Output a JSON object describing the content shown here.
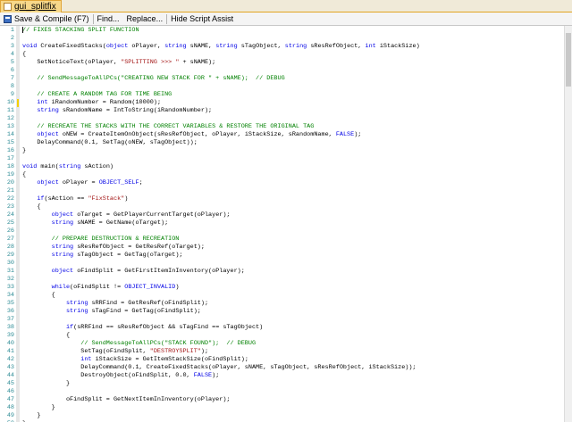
{
  "tab": {
    "label": "gui_splitfix"
  },
  "toolbar": {
    "save_label": "Save & Compile (F7)",
    "find_label": "Find...",
    "replace_label": "Replace...",
    "hide_assist_label": "Hide Script Assist"
  },
  "colors": {
    "keyword": "#0000e6",
    "comment": "#008000",
    "string": "#a31515",
    "line_number": "#2b8a94",
    "change_marker": "#f4d000"
  },
  "lines": [
    {
      "n": "1",
      "tokens": [
        {
          "t": "cmt",
          "v": "// FIXES STACKING SPLIT FUNCTION"
        }
      ]
    },
    {
      "n": "2",
      "tokens": []
    },
    {
      "n": "3",
      "tokens": [
        {
          "t": "kw",
          "v": "void"
        },
        {
          "t": "n",
          "v": " CreateFixedStacks("
        },
        {
          "t": "kw",
          "v": "object"
        },
        {
          "t": "n",
          "v": " oPlayer, "
        },
        {
          "t": "kw",
          "v": "string"
        },
        {
          "t": "n",
          "v": " sNAME, "
        },
        {
          "t": "kw",
          "v": "string"
        },
        {
          "t": "n",
          "v": " sTagObject, "
        },
        {
          "t": "kw",
          "v": "string"
        },
        {
          "t": "n",
          "v": " sResRefObject, "
        },
        {
          "t": "kw",
          "v": "int"
        },
        {
          "t": "n",
          "v": " iStackSize)"
        }
      ]
    },
    {
      "n": "4",
      "tokens": [
        {
          "t": "n",
          "v": "{"
        }
      ]
    },
    {
      "n": "5",
      "tokens": [
        {
          "t": "n",
          "v": "    SetNoticeText(oPlayer, "
        },
        {
          "t": "str",
          "v": "\"SPLITTING >>> \""
        },
        {
          "t": "n",
          "v": " + sNAME);"
        }
      ]
    },
    {
      "n": "6",
      "tokens": []
    },
    {
      "n": "7",
      "tokens": [
        {
          "t": "cmt",
          "v": "    // SendMessageToAllPCs(\"CREATING NEW STACK FOR \" + sNAME);  // DEBUG"
        }
      ]
    },
    {
      "n": "8",
      "tokens": []
    },
    {
      "n": "9",
      "tokens": [
        {
          "t": "cmt",
          "v": "    // CREATE A RANDOM TAG FOR TIME BEING"
        }
      ]
    },
    {
      "n": "10",
      "tokens": [
        {
          "t": "n",
          "v": "    "
        },
        {
          "t": "kw",
          "v": "int"
        },
        {
          "t": "n",
          "v": " iRandomNumber = Random(10000);"
        }
      ],
      "changed": true
    },
    {
      "n": "11",
      "tokens": [
        {
          "t": "n",
          "v": "    "
        },
        {
          "t": "kw",
          "v": "string"
        },
        {
          "t": "n",
          "v": " sRandomName = IntToString(iRandomNumber);"
        }
      ]
    },
    {
      "n": "12",
      "tokens": []
    },
    {
      "n": "13",
      "tokens": [
        {
          "t": "cmt",
          "v": "    // RECREATE THE STACKS WITH THE CORRECT VARIABLES & RESTORE THE ORIGINAL TAG"
        }
      ]
    },
    {
      "n": "14",
      "tokens": [
        {
          "t": "n",
          "v": "    "
        },
        {
          "t": "kw",
          "v": "object"
        },
        {
          "t": "n",
          "v": " oNEW = CreateItemOnObject(sResRefObject, oPlayer, iStackSize, sRandomName, "
        },
        {
          "t": "const",
          "v": "FALSE"
        },
        {
          "t": "n",
          "v": ");"
        }
      ]
    },
    {
      "n": "15",
      "tokens": [
        {
          "t": "n",
          "v": "    DelayCommand(0.1, SetTag(oNEW, sTagObject));"
        }
      ]
    },
    {
      "n": "16",
      "tokens": [
        {
          "t": "n",
          "v": "}"
        }
      ]
    },
    {
      "n": "17",
      "tokens": []
    },
    {
      "n": "18",
      "tokens": [
        {
          "t": "kw",
          "v": "void"
        },
        {
          "t": "n",
          "v": " main("
        },
        {
          "t": "kw",
          "v": "string"
        },
        {
          "t": "n",
          "v": " sAction)"
        }
      ]
    },
    {
      "n": "19",
      "tokens": [
        {
          "t": "n",
          "v": "{"
        }
      ]
    },
    {
      "n": "20",
      "tokens": [
        {
          "t": "n",
          "v": "    "
        },
        {
          "t": "kw",
          "v": "object"
        },
        {
          "t": "n",
          "v": " oPlayer = "
        },
        {
          "t": "const",
          "v": "OBJECT_SELF"
        },
        {
          "t": "n",
          "v": ";"
        }
      ]
    },
    {
      "n": "21",
      "tokens": []
    },
    {
      "n": "22",
      "tokens": [
        {
          "t": "n",
          "v": "    "
        },
        {
          "t": "kw",
          "v": "if"
        },
        {
          "t": "n",
          "v": "(sAction == "
        },
        {
          "t": "str",
          "v": "\"FixStack\""
        },
        {
          "t": "n",
          "v": ")"
        }
      ]
    },
    {
      "n": "23",
      "tokens": [
        {
          "t": "n",
          "v": "    {"
        }
      ]
    },
    {
      "n": "24",
      "tokens": [
        {
          "t": "n",
          "v": "        "
        },
        {
          "t": "kw",
          "v": "object"
        },
        {
          "t": "n",
          "v": " oTarget = GetPlayerCurrentTarget(oPlayer);"
        }
      ]
    },
    {
      "n": "25",
      "tokens": [
        {
          "t": "n",
          "v": "        "
        },
        {
          "t": "kw",
          "v": "string"
        },
        {
          "t": "n",
          "v": " sNAME = GetName(oTarget);"
        }
      ]
    },
    {
      "n": "26",
      "tokens": []
    },
    {
      "n": "27",
      "tokens": [
        {
          "t": "cmt",
          "v": "        // PREPARE DESTRUCTION & RECREATION"
        }
      ]
    },
    {
      "n": "28",
      "tokens": [
        {
          "t": "n",
          "v": "        "
        },
        {
          "t": "kw",
          "v": "string"
        },
        {
          "t": "n",
          "v": " sResRefObject = GetResRef(oTarget);"
        }
      ]
    },
    {
      "n": "29",
      "tokens": [
        {
          "t": "n",
          "v": "        "
        },
        {
          "t": "kw",
          "v": "string"
        },
        {
          "t": "n",
          "v": " sTagObject = GetTag(oTarget);"
        }
      ]
    },
    {
      "n": "30",
      "tokens": []
    },
    {
      "n": "31",
      "tokens": [
        {
          "t": "n",
          "v": "        "
        },
        {
          "t": "kw",
          "v": "object"
        },
        {
          "t": "n",
          "v": " oFindSplit = GetFirstItemInInventory(oPlayer);"
        }
      ]
    },
    {
      "n": "32",
      "tokens": []
    },
    {
      "n": "33",
      "tokens": [
        {
          "t": "n",
          "v": "        "
        },
        {
          "t": "kw",
          "v": "while"
        },
        {
          "t": "n",
          "v": "(oFindSplit != "
        },
        {
          "t": "const",
          "v": "OBJECT_INVALID"
        },
        {
          "t": "n",
          "v": ")"
        }
      ]
    },
    {
      "n": "34",
      "tokens": [
        {
          "t": "n",
          "v": "        {"
        }
      ]
    },
    {
      "n": "35",
      "tokens": [
        {
          "t": "n",
          "v": "            "
        },
        {
          "t": "kw",
          "v": "string"
        },
        {
          "t": "n",
          "v": " sRRFind = GetResRef(oFindSplit);"
        }
      ]
    },
    {
      "n": "36",
      "tokens": [
        {
          "t": "n",
          "v": "            "
        },
        {
          "t": "kw",
          "v": "string"
        },
        {
          "t": "n",
          "v": " sTagFind = GetTag(oFindSplit);"
        }
      ]
    },
    {
      "n": "37",
      "tokens": []
    },
    {
      "n": "38",
      "tokens": [
        {
          "t": "n",
          "v": "            "
        },
        {
          "t": "kw",
          "v": "if"
        },
        {
          "t": "n",
          "v": "(sRRFind == sResRefObject && sTagFind == sTagObject)"
        }
      ]
    },
    {
      "n": "39",
      "tokens": [
        {
          "t": "n",
          "v": "            {"
        }
      ]
    },
    {
      "n": "40",
      "tokens": [
        {
          "t": "cmt",
          "v": "                // SendMessageToAllPCs(\"STACK FOUND\");  // DEBUG"
        }
      ]
    },
    {
      "n": "41",
      "tokens": [
        {
          "t": "n",
          "v": "                SetTag(oFindSplit, "
        },
        {
          "t": "str",
          "v": "\"DESTROYSPLIT\""
        },
        {
          "t": "n",
          "v": ");"
        }
      ]
    },
    {
      "n": "42",
      "tokens": [
        {
          "t": "n",
          "v": "                "
        },
        {
          "t": "kw",
          "v": "int"
        },
        {
          "t": "n",
          "v": " iStackSize = GetItemStackSize(oFindSplit);"
        }
      ]
    },
    {
      "n": "43",
      "tokens": [
        {
          "t": "n",
          "v": "                DelayCommand(0.1, CreateFixedStacks(oPlayer, sNAME, sTagObject, sResRefObject, iStackSize));"
        }
      ]
    },
    {
      "n": "44",
      "tokens": [
        {
          "t": "n",
          "v": "                DestroyObject(oFindSplit, 0.0, "
        },
        {
          "t": "const",
          "v": "FALSE"
        },
        {
          "t": "n",
          "v": ");"
        }
      ]
    },
    {
      "n": "45",
      "tokens": [
        {
          "t": "n",
          "v": "            }"
        }
      ]
    },
    {
      "n": "46",
      "tokens": []
    },
    {
      "n": "47",
      "tokens": [
        {
          "t": "n",
          "v": "            oFindSplit = GetNextItemInInventory(oPlayer);"
        }
      ]
    },
    {
      "n": "48",
      "tokens": [
        {
          "t": "n",
          "v": "        }"
        }
      ]
    },
    {
      "n": "49",
      "tokens": [
        {
          "t": "n",
          "v": "    }"
        }
      ]
    },
    {
      "n": "50",
      "tokens": [
        {
          "t": "n",
          "v": "}"
        }
      ]
    }
  ]
}
